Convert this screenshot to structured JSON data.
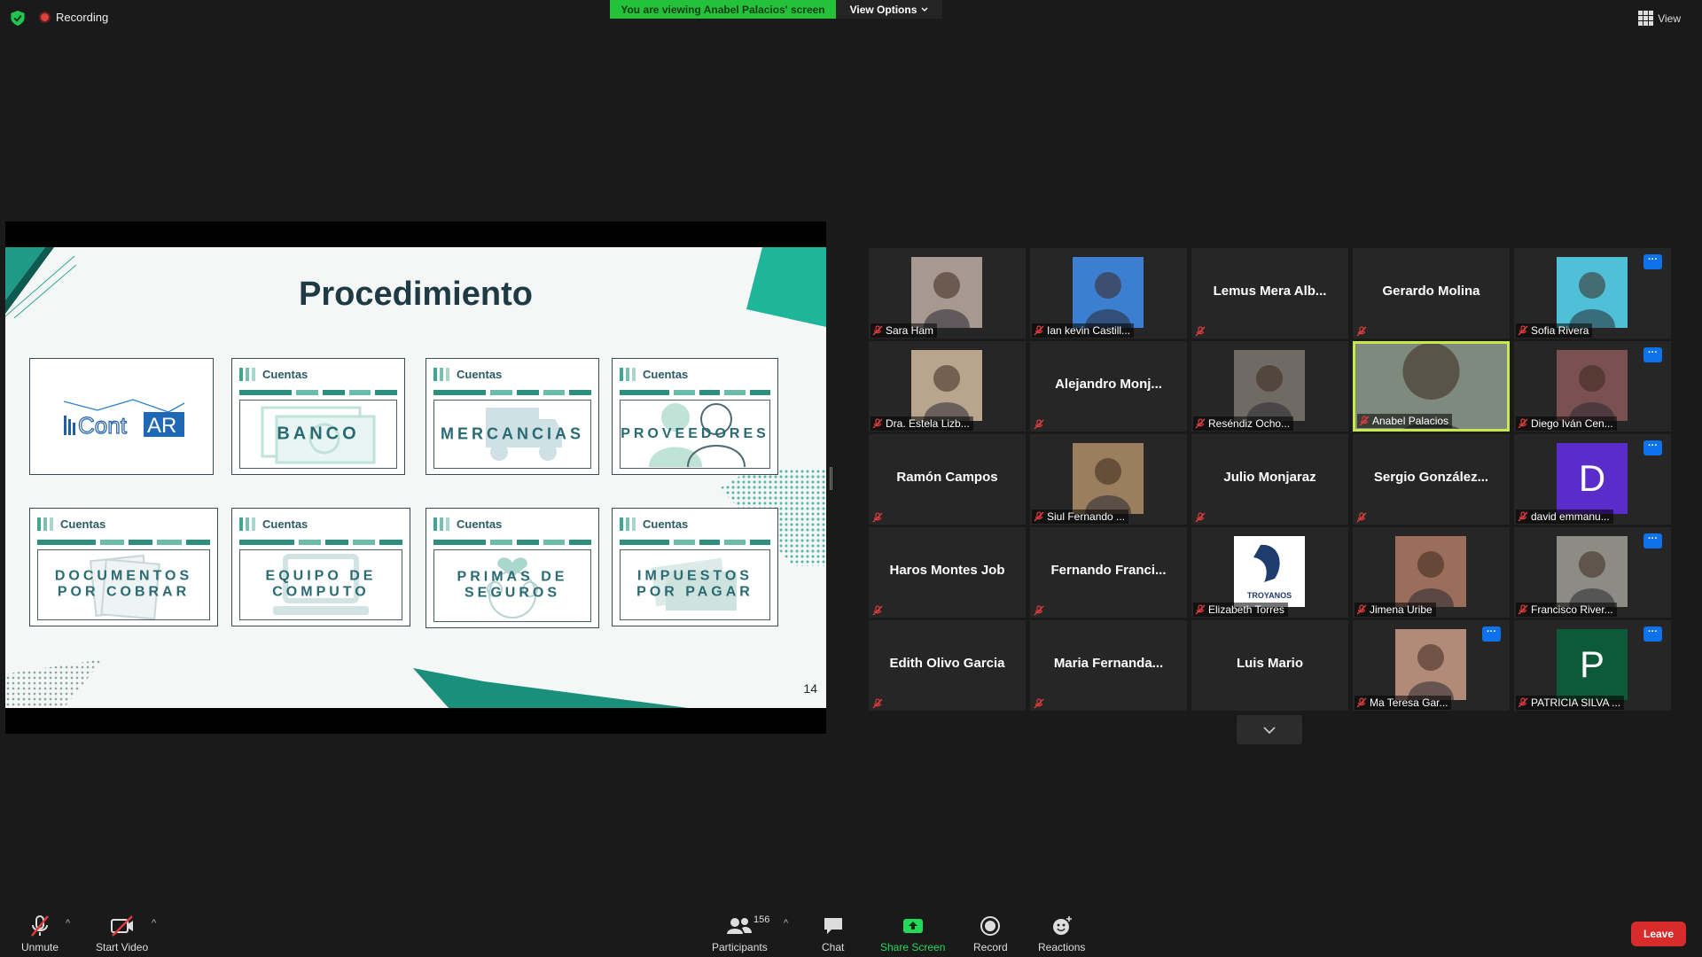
{
  "top": {
    "recording_label": "Recording",
    "viewing_banner": "You are viewing Anabel Palacios' screen",
    "view_options_label": "View Options",
    "view_label": "View"
  },
  "slide": {
    "title": "Procedimiento",
    "page_number": "14",
    "logo_text": "ContAR",
    "cards": [
      {
        "header": "Cuentas",
        "word": "BANCO"
      },
      {
        "header": "Cuentas",
        "word": "MERCANCIAS"
      },
      {
        "header": "Cuentas",
        "word": "PROVEEDORES"
      },
      {
        "header": "Cuentas",
        "word_line1": "DOCUMENTOS",
        "word_line2": "POR COBRAR"
      },
      {
        "header": "Cuentas",
        "word_line1": "EQUIPO DE",
        "word_line2": "COMPUTO"
      },
      {
        "header": "Cuentas",
        "word_line1": "PRIMAS DE",
        "word_line2": "SEGUROS"
      },
      {
        "header": "Cuentas",
        "word_line1": "IMPUESTOS",
        "word_line2": "POR PAGAR"
      }
    ]
  },
  "participants": [
    {
      "label": "Sara Ham",
      "kind": "photo",
      "photo_color": "#a79890"
    },
    {
      "label": "Ian kevin Castill...",
      "kind": "photo",
      "photo_color": "#3c7fd0"
    },
    {
      "label": "",
      "display": "Lemus Mera Alb...",
      "kind": "name"
    },
    {
      "label": "",
      "display": "Gerardo Molina",
      "kind": "name"
    },
    {
      "label": "Sofia Rivera",
      "kind": "photo",
      "photo_color": "#4fc0d8",
      "menu": true
    },
    {
      "label": "Dra. Estela Lizb...",
      "kind": "photo",
      "photo_color": "#b9a48e"
    },
    {
      "label": "",
      "display": "Alejandro Monj...",
      "kind": "name"
    },
    {
      "label": "Reséndiz Ocho...",
      "kind": "photo",
      "photo_color": "#6f6a63"
    },
    {
      "label": "Anabel Palacios",
      "kind": "photo",
      "photo_color": "#7e8a7d",
      "active": true
    },
    {
      "label": "Diego Iván Cen...",
      "kind": "photo",
      "photo_color": "#7a5050",
      "menu": true
    },
    {
      "label": "",
      "display": "Ramón Campos",
      "kind": "name"
    },
    {
      "label": "Siul Fernando ...",
      "kind": "photo",
      "photo_color": "#9a7e5e"
    },
    {
      "label": "",
      "display": "Julio Monjaraz",
      "kind": "name"
    },
    {
      "label": "",
      "display": "Sergio González...",
      "kind": "name"
    },
    {
      "label": "david emmanu...",
      "kind": "letter",
      "letter": "D",
      "letter_bg": "#5a2cc9",
      "menu": true
    },
    {
      "label": "",
      "display": "Haros Montes Job",
      "kind": "name"
    },
    {
      "label": "",
      "display": "Fernando Franci...",
      "kind": "name"
    },
    {
      "label": "Elizabeth Torres",
      "kind": "photo",
      "photo_color": "#ffffff",
      "logo_text": "TROYANOS"
    },
    {
      "label": "Jimena Uribe",
      "kind": "photo",
      "photo_color": "#9a6e5a"
    },
    {
      "label": "Francisco River...",
      "kind": "photo",
      "photo_color": "#8c8c84",
      "menu": true
    },
    {
      "label": "",
      "display": "Edith Olivo Garcia",
      "kind": "name"
    },
    {
      "label": "",
      "display": "Maria Fernanda...",
      "kind": "name"
    },
    {
      "label": "",
      "display": "Luis Mario",
      "kind": "name",
      "nomute": true
    },
    {
      "label": "Ma Teresa Gar...",
      "kind": "photo",
      "photo_color": "#b28a78",
      "menu": true
    },
    {
      "label": "PATRICIA SILVA ...",
      "kind": "letter",
      "letter": "P",
      "letter_bg": "#0d5a3a",
      "menu": true
    }
  ],
  "toolbar": {
    "unmute": "Unmute",
    "start_video": "Start Video",
    "participants": "Participants",
    "participant_count": "156",
    "chat": "Chat",
    "share_screen": "Share Screen",
    "record": "Record",
    "reactions": "Reactions",
    "leave": "Leave"
  },
  "colors": {
    "banner_green": "#24c13a",
    "share_green": "#23d959",
    "leave_red": "#d82b2b",
    "active_speaker": "#c7e94a",
    "menu_blue": "#0e72ed",
    "slide_teal": "#1fa58e"
  }
}
